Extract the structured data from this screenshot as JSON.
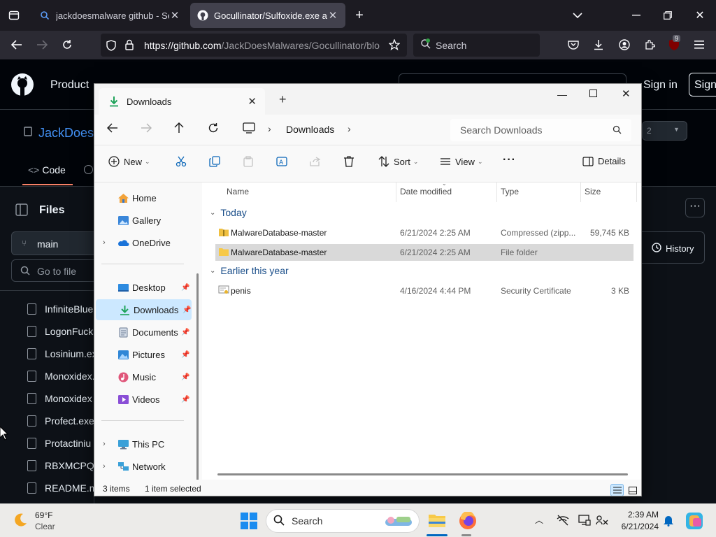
{
  "browser": {
    "tabs": [
      {
        "title": "jackdoesmalware github - Sear",
        "active": false
      },
      {
        "title": "Gocullinator/Sulfoxide.exe at m",
        "active": true
      }
    ],
    "url_host": "https://github.com",
    "url_path": "/JackDoesMalwares/Gocullinator/blo",
    "search_placeholder": "Search",
    "extension_badge": "9"
  },
  "github": {
    "nav_product": "Product",
    "sign_in": "Sign in",
    "sign_up": "Sign",
    "repo_owner": "JackDoes",
    "code_tab": "Code",
    "files_title": "Files",
    "branch": "main",
    "goto_file_placeholder": "Go to file",
    "history_label": "History",
    "count_badge": "2",
    "files": [
      "InfiniteBlue.",
      "LogonFuck.",
      "Losinium.ex",
      "Monoxidex.",
      "Monoxidex",
      "Profect.exe",
      "Protactiniu",
      "RBXMCPQK",
      "README.m"
    ]
  },
  "explorer": {
    "tab_title": "Downloads",
    "breadcrumb": "Downloads",
    "search_placeholder": "Search Downloads",
    "toolbar": {
      "new": "New",
      "sort": "Sort",
      "view": "View",
      "more": "···",
      "details": "Details"
    },
    "nav": {
      "home": "Home",
      "gallery": "Gallery",
      "onedrive": "OneDrive",
      "desktop": "Desktop",
      "downloads": "Downloads",
      "documents": "Documents",
      "pictures": "Pictures",
      "music": "Music",
      "videos": "Videos",
      "thispc": "This PC",
      "network": "Network"
    },
    "columns": {
      "name": "Name",
      "date": "Date modified",
      "type": "Type",
      "size": "Size"
    },
    "groups": [
      {
        "label": "Today",
        "rows": [
          {
            "name": "MalwareDatabase-master",
            "date": "6/21/2024 2:25 AM",
            "type": "Compressed (zipp...",
            "size": "59,745 KB",
            "icon": "zip-folder-icon",
            "selected": false
          },
          {
            "name": "MalwareDatabase-master",
            "date": "6/21/2024 2:25 AM",
            "type": "File folder",
            "size": "",
            "icon": "folder-icon",
            "selected": true
          }
        ]
      },
      {
        "label": "Earlier this year",
        "rows": [
          {
            "name": "penis",
            "date": "4/16/2024 4:44 PM",
            "type": "Security Certificate",
            "size": "3 KB",
            "icon": "certificate-icon",
            "selected": false
          }
        ]
      }
    ],
    "status": {
      "items": "3 items",
      "selected": "1 item selected"
    }
  },
  "taskbar": {
    "weather_temp": "69°F",
    "weather_desc": "Clear",
    "search_placeholder": "Search",
    "time": "2:39 AM",
    "date": "6/21/2024"
  },
  "colors": {
    "accent": "#0078d4",
    "selected_row": "#d9d9d9",
    "nav_selected": "#cce8ff",
    "folder": "#f7c948"
  }
}
